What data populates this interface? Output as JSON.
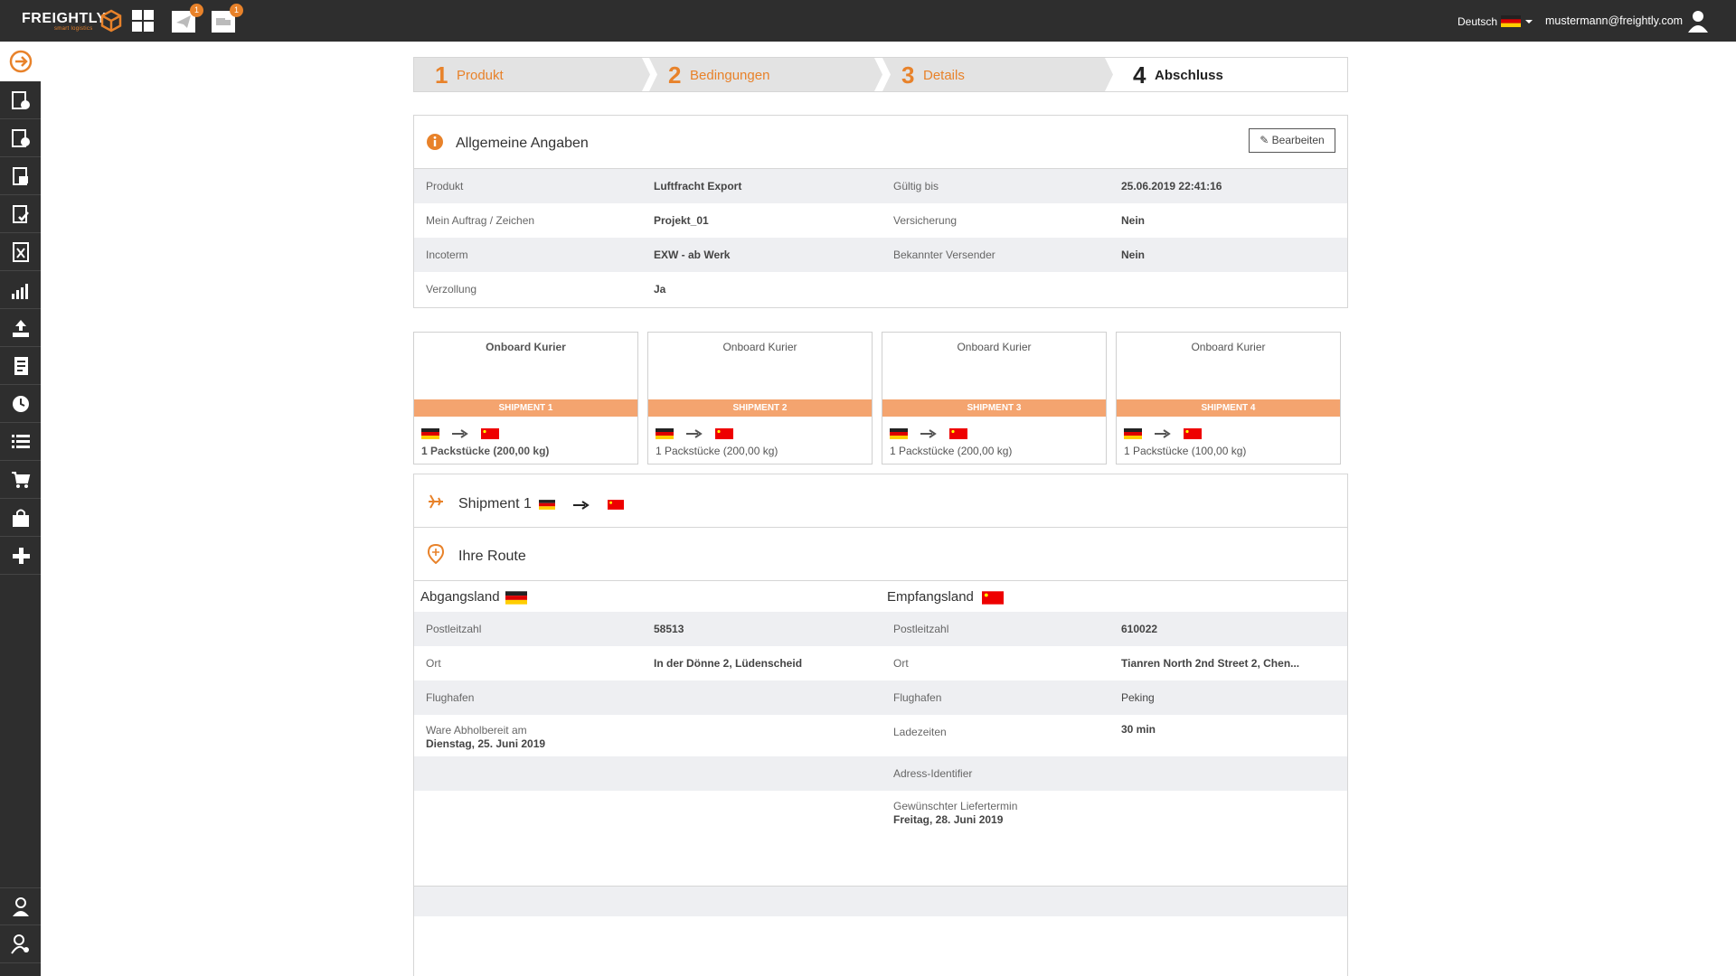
{
  "app": {
    "logo": "FREIGHTLY",
    "logo_sub": "smart logistics",
    "notif_badge_1": "1",
    "notif_badge_2": "1",
    "language": "Deutsch",
    "user_email": "mustermann@freightly.com"
  },
  "steps": [
    {
      "num": "1",
      "label": "Produkt"
    },
    {
      "num": "2",
      "label": "Bedingungen"
    },
    {
      "num": "3",
      "label": "Details"
    },
    {
      "num": "4",
      "label": "Abschluss"
    }
  ],
  "general": {
    "title": "Allgemeine Angaben",
    "edit_label": "Bearbeiten",
    "rows": [
      {
        "l1": "Produkt",
        "v1": "Luftfracht Export",
        "l2": "Gültig bis",
        "v2": "25.06.2019 22:41:16"
      },
      {
        "l1": "Mein Auftrag / Zeichen",
        "v1": "Projekt_01",
        "l2": "Versicherung",
        "v2": "Nein"
      },
      {
        "l1": "Incoterm",
        "v1": "EXW - ab Werk",
        "l2": "Bekannter Versender",
        "v2": "Nein"
      },
      {
        "l1": "Verzollung",
        "v1": "Ja",
        "l2": "",
        "v2": ""
      }
    ]
  },
  "shipments": [
    {
      "service": "Onboard Kurier",
      "label": "SHIPMENT 1",
      "info": "1 Packstücke (200,00 kg)"
    },
    {
      "service": "Onboard Kurier",
      "label": "SHIPMENT 2",
      "info": "1 Packstücke (200,00 kg)"
    },
    {
      "service": "Onboard Kurier",
      "label": "SHIPMENT 3",
      "info": "1 Packstücke (200,00 kg)"
    },
    {
      "service": "Onboard Kurier",
      "label": "SHIPMENT 4",
      "info": "1 Packstücke (100,00 kg)"
    }
  ],
  "shipment_detail": {
    "title": "Shipment 1",
    "route_title": "Ihre Route",
    "origin_title": "Abgangsland",
    "dest_title": "Empfangsland",
    "origin": {
      "postal_label": "Postleitzahl",
      "postal": "58513",
      "city_label": "Ort",
      "city": "In der Dönne 2, Lüdenscheid",
      "airport_label": "Flughafen",
      "airport": "",
      "ready_label": "Ware Abholbereit am",
      "ready": "Dienstag, 25. Juni 2019"
    },
    "destination": {
      "postal_label": "Postleitzahl",
      "postal": "610022",
      "city_label": "Ort",
      "city": "Tianren North 2nd Street 2, Chen...",
      "airport_label": "Flughafen",
      "airport": "Peking",
      "load_label": "Ladezeiten",
      "load": "30 min",
      "addr_label": "Adress-Identifier",
      "delivery_label": "Gewünschter Liefertermin",
      "delivery": "Freitag, 28. Juni 2019"
    }
  },
  "colors": {
    "accent": "#e8822a",
    "sidebar": "#2e2e2e",
    "card_bar": "#f4a46f",
    "row_grey": "#eeeff2"
  },
  "icons": {
    "sidebar": [
      "arrow-circle-icon",
      "new-shipment-icon",
      "add-shipment-icon",
      "documents-icon",
      "document-check-icon",
      "excel-icon",
      "statistics-icon",
      "upload-icon",
      "invoice-icon",
      "clock-icon",
      "list-icon",
      "cart-icon",
      "shop-bag-icon",
      "plus-icon",
      "user-icon",
      "user-settings-icon"
    ]
  }
}
